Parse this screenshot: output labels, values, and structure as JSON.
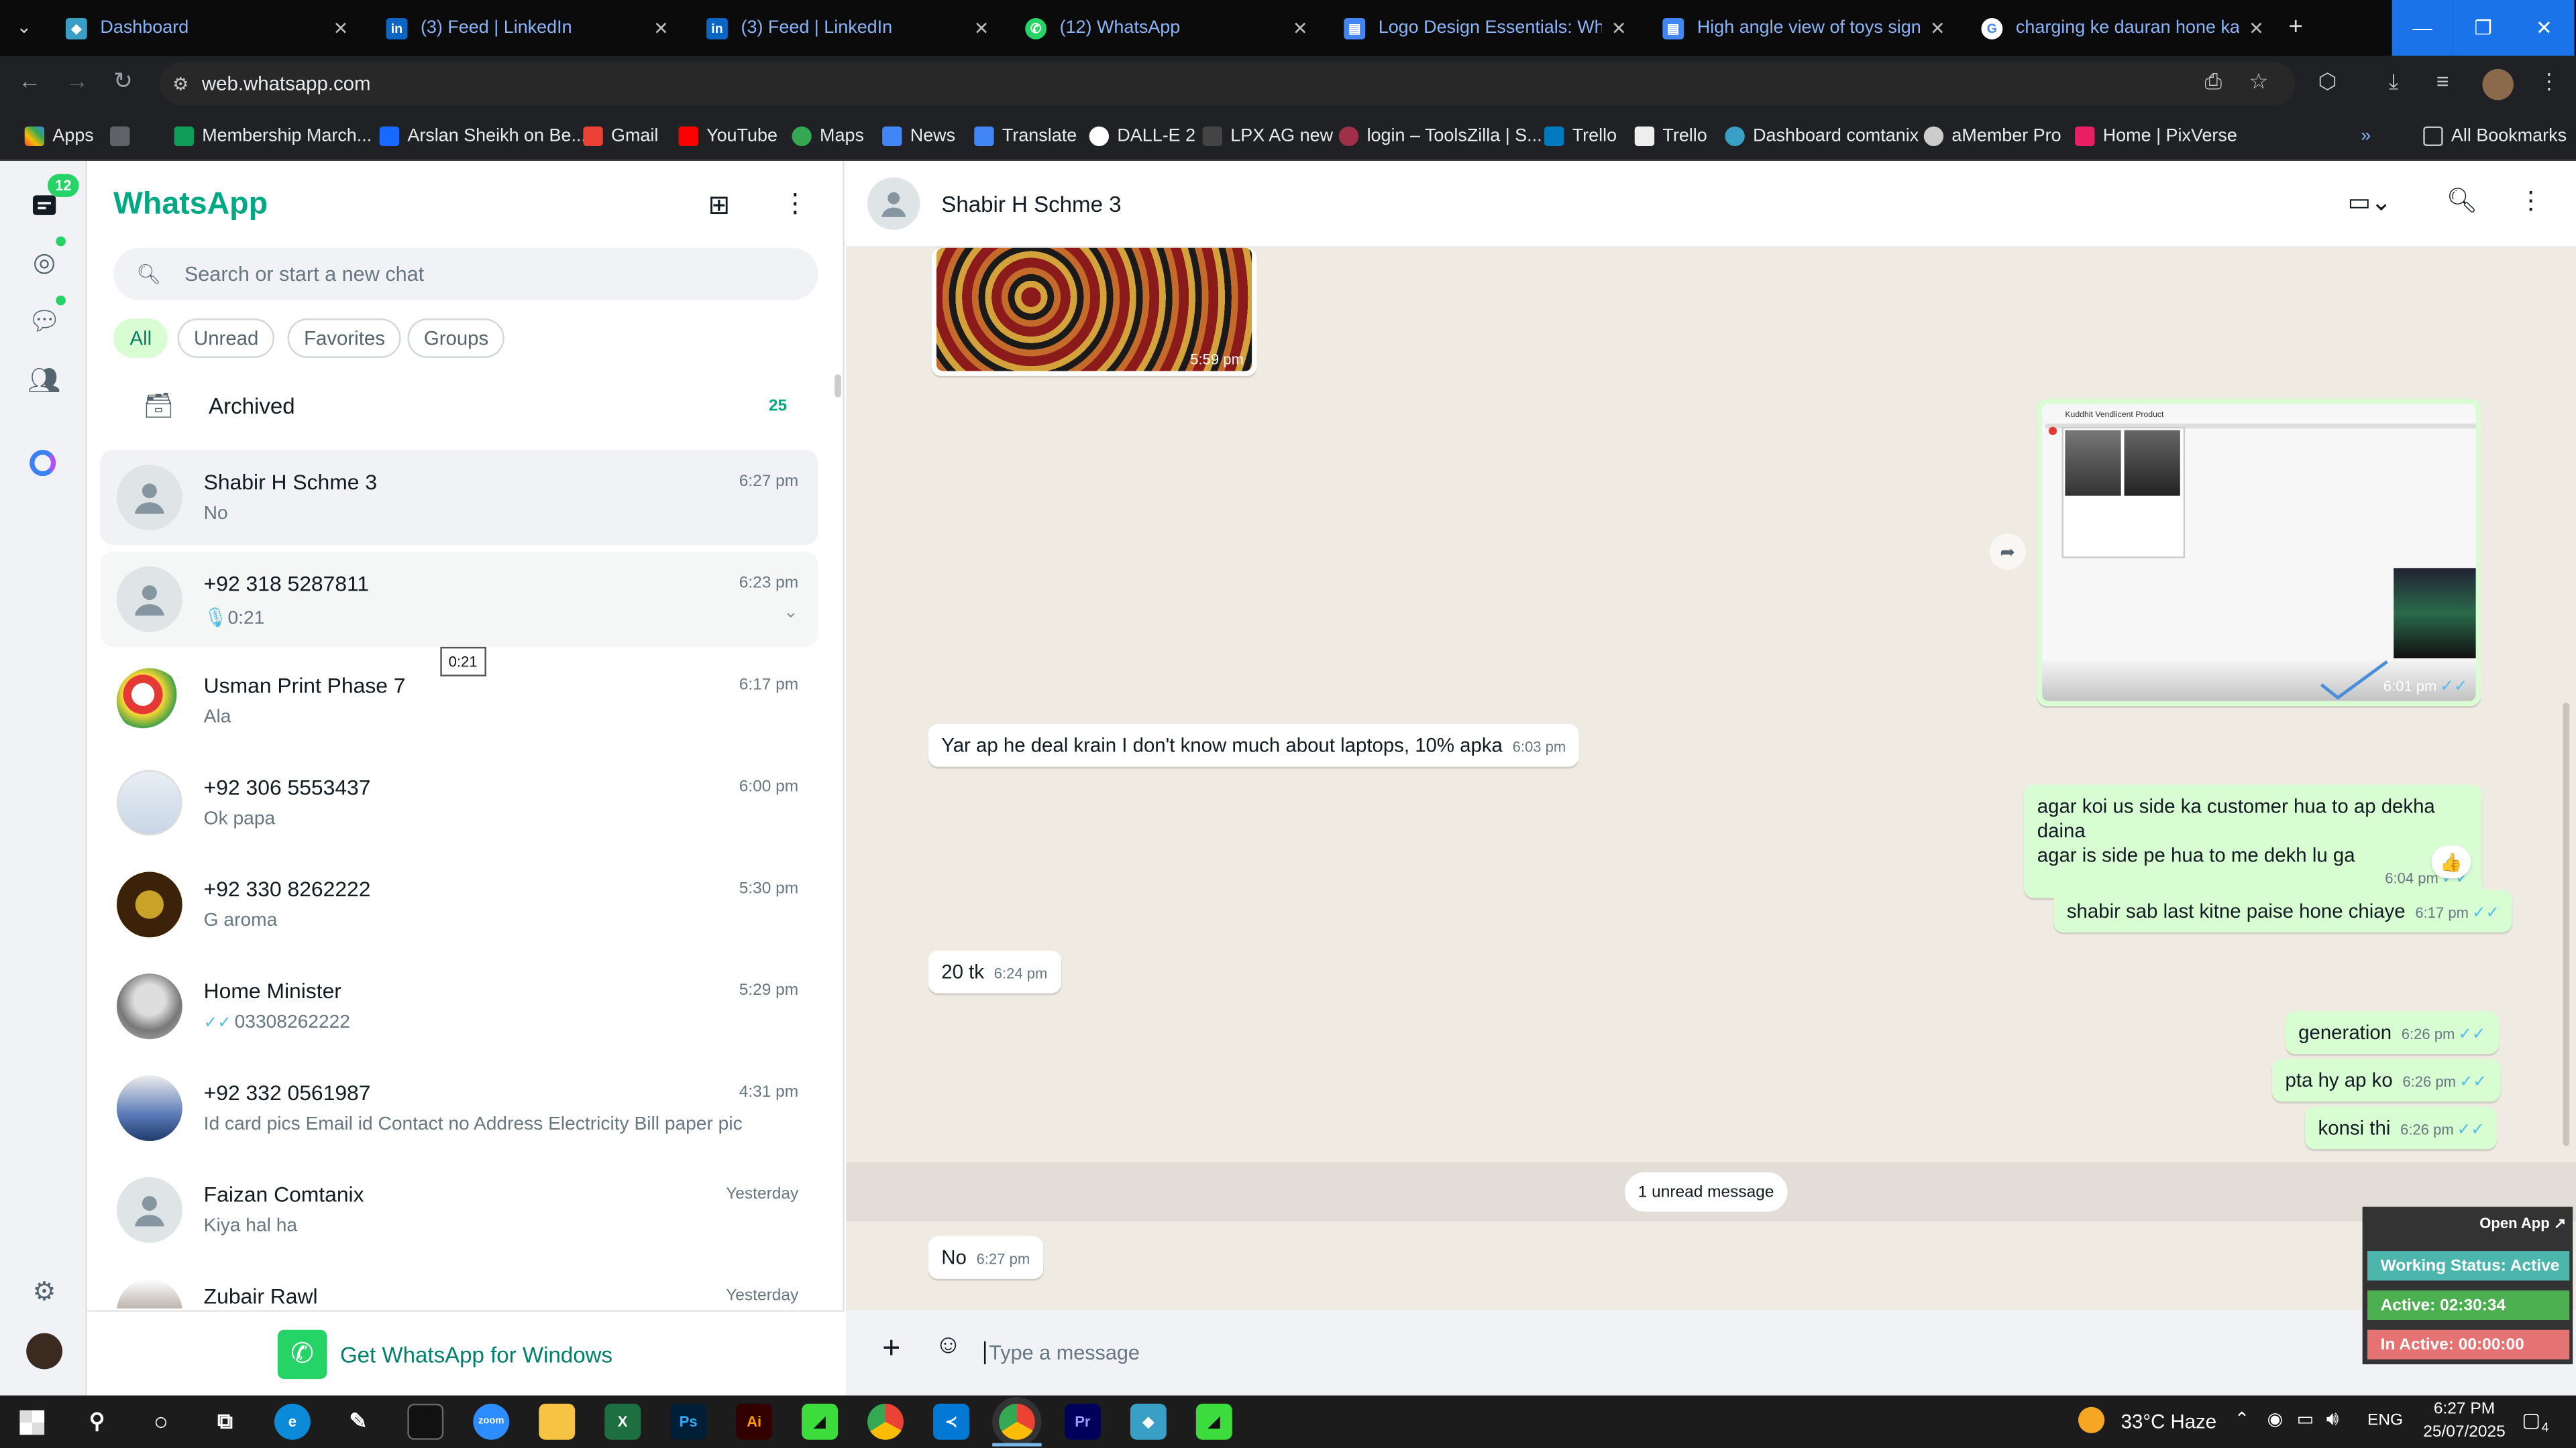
{
  "browser": {
    "tabs": [
      {
        "label": "Dashboard",
        "icon": "dashboard-icon",
        "color": "#3a9fc4"
      },
      {
        "label": "(3) Feed | LinkedIn",
        "icon": "linkedin-icon",
        "color": "#0a66c2"
      },
      {
        "label": "(3) Feed | LinkedIn",
        "icon": "linkedin-icon",
        "color": "#0a66c2"
      },
      {
        "label": "(12) WhatsApp",
        "icon": "whatsapp-icon",
        "color": "#25d366"
      },
      {
        "label": "Logo Design Essentials: What E",
        "icon": "doc-icon",
        "color": "#4285f4"
      },
      {
        "label": "High angle view of toys sign | F",
        "icon": "doc-icon",
        "color": "#4285f4"
      },
      {
        "label": "charging ke dauran hone ka us",
        "icon": "google-icon",
        "color": "#ffffff"
      }
    ],
    "url": "web.whatsapp.com",
    "bookmarks": [
      "Apps",
      "Membership March...",
      "Arslan Sheikh on Be...",
      "Gmail",
      "YouTube",
      "Maps",
      "News",
      "Translate",
      "DALL-E 2",
      "LPX AG new",
      "login – ToolsZilla | S...",
      "Trello",
      "Trello",
      "Dashboard comtanix",
      "aMember Pro",
      "Home | PixVerse"
    ],
    "all_bookmarks": "All Bookmarks"
  },
  "sidebar": {
    "title": "WhatsApp",
    "chats_badge": "12",
    "search_placeholder": "Search or start a new chat",
    "filters": [
      "All",
      "Unread",
      "Favorites",
      "Groups"
    ],
    "archived_label": "Archived",
    "archived_count": "25",
    "tooltip": "0:21",
    "chats": [
      {
        "name": "Shabir H  Schme 3",
        "preview": "No",
        "time": "6:27 pm"
      },
      {
        "name": "+92 318 5287811",
        "preview": "0:21",
        "time": "6:23 pm"
      },
      {
        "name": "Usman Print Phase 7",
        "preview": "Ala",
        "time": "6:17 pm"
      },
      {
        "name": "+92 306 5553437",
        "preview": "Ok papa",
        "time": "6:00 pm"
      },
      {
        "name": "+92 330 8262222",
        "preview": "G aroma",
        "time": "5:30 pm"
      },
      {
        "name": "Home Minister",
        "preview": "03308262222",
        "time": "5:29 pm"
      },
      {
        "name": "+92 332 0561987",
        "preview": "Id card pics Email id  Contact no Address Electricity Bill paper pic",
        "time": "4:31 pm"
      },
      {
        "name": "Faizan Comtanix",
        "preview": "Kiya hal ha",
        "time": "Yesterday"
      },
      {
        "name": "Zubair Rawl",
        "preview": "",
        "time": "Yesterday"
      }
    ],
    "get_app": "Get WhatsApp for Windows"
  },
  "chat": {
    "contact_name": "Shabir H  Schme 3",
    "messages": [
      {
        "dir": "in",
        "kind": "image",
        "time": "5:59 pm"
      },
      {
        "dir": "out",
        "kind": "image",
        "time": "6:01 pm"
      },
      {
        "dir": "in",
        "text": "Yar ap he deal krain I don't know much about laptops, 10% apka",
        "time": "6:03 pm"
      },
      {
        "dir": "out",
        "text_line1": "agar koi  us side ka customer hua to ap dekha daina",
        "text_line2": "agar is side pe hua to me dekh lu ga",
        "time": "6:04 pm",
        "reaction": "👍"
      },
      {
        "dir": "out",
        "text": "shabir sab last kitne paise hone chiaye",
        "time": "6:17 pm"
      },
      {
        "dir": "in",
        "text": "20 tk",
        "time": "6:24 pm"
      },
      {
        "dir": "out",
        "text": "generation",
        "time": "6:26 pm"
      },
      {
        "dir": "out",
        "text": "pta hy ap ko",
        "time": "6:26 pm"
      },
      {
        "dir": "out",
        "text": "konsi thi",
        "time": "6:26 pm"
      },
      {
        "dir": "in",
        "text": "No",
        "time": "6:27 pm"
      }
    ],
    "unread_divider": "1 unread message",
    "composer_placeholder": "Type a message",
    "screenshot_title": "Kuddhit Vendlicent Product"
  },
  "widget": {
    "open_app": "Open App ↗",
    "status": "Working Status: Active",
    "active": "Active: 02:30:34",
    "inactive": "In Active: 00:00:00",
    "colors": {
      "status": "#4db6ac",
      "active": "#4caf50",
      "inactive": "#e57373"
    }
  },
  "taskbar": {
    "weather": "33°C  Haze",
    "lang": "ENG",
    "time": "6:27 PM",
    "date": "25/07/2025",
    "notif_count": "4"
  },
  "colors": {
    "wa_green": "#00a884",
    "outgoing": "#d9fdd3",
    "chat_bg": "#efeae2"
  }
}
